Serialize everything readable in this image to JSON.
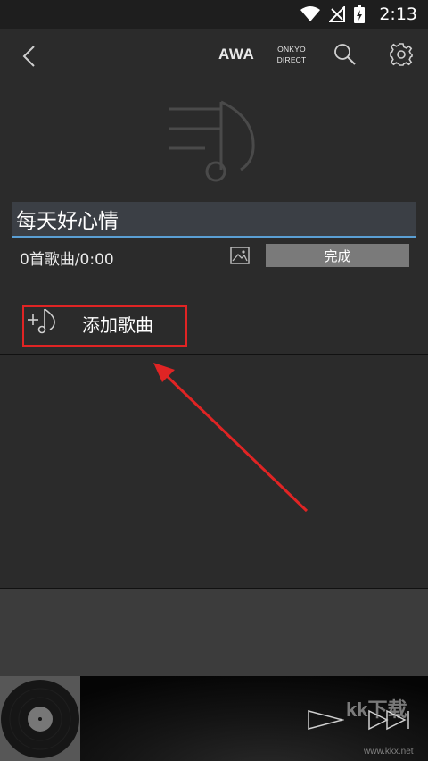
{
  "status_bar": {
    "time": "2:13",
    "icons": [
      "wifi-icon",
      "signal-icon",
      "battery-charging-icon"
    ]
  },
  "toolbar": {
    "back_icon": "chevron-left-icon",
    "awa_label": "AWA",
    "onkyo_line1": "ONKYO",
    "onkyo_line2": "DIRECT",
    "search_icon": "search-icon",
    "settings_icon": "gear-icon"
  },
  "playlist": {
    "artwork_icon": "playlist-music-note-icon",
    "title_value": "每天好心情",
    "info": "0首歌曲/0:00",
    "image_icon": "image-icon",
    "done_label": "完成"
  },
  "add_song": {
    "icon": "add-music-note-icon",
    "label": "添加歌曲"
  },
  "player": {
    "album_icon": "vinyl-record-icon",
    "play_icon": "play-icon",
    "next_icon": "skip-next-icon",
    "watermark": "kk下载",
    "watermark_url": "www.kkx.net"
  },
  "colors": {
    "background": "#2b2b2b",
    "status_bar": "#1e1e1e",
    "input_underline": "#5a9fd4",
    "done_button": "#7a7a7a",
    "annotation": "#e02424"
  }
}
